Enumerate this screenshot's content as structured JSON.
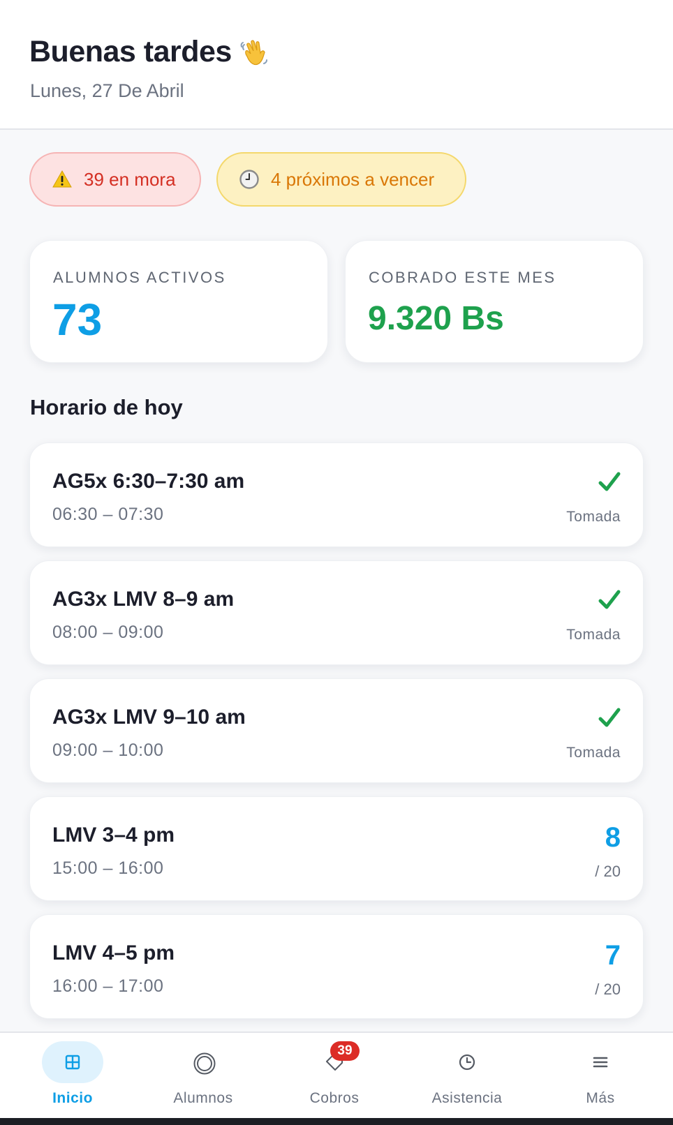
{
  "header": {
    "greeting": "Buenas tardes",
    "greeting_icon": "waving-hand-icon",
    "date": "Lunes, 27 De Abril"
  },
  "alerts": {
    "mora": {
      "icon": "warning-icon",
      "label": "39 en mora",
      "color": "#d42f23"
    },
    "vencer": {
      "icon": "clock-icon",
      "label": "4 próximos a vencer",
      "color": "#d97706"
    }
  },
  "stats": {
    "alumnos": {
      "label": "ALUMNOS ACTIVOS",
      "value": "73",
      "color": "#0e9ee5"
    },
    "cobrado": {
      "label": "COBRADO ESTE MES",
      "value": "9.320 Bs",
      "color": "#1ea14d"
    }
  },
  "schedule": {
    "title": "Horario de hoy",
    "classes": [
      {
        "name": "AG5x 6:30–7:30 am",
        "time": "06:30 – 07:30",
        "status": "Tomada"
      },
      {
        "name": "AG3x LMV 8–9 am",
        "time": "08:00 – 09:00",
        "status": "Tomada"
      },
      {
        "name": "AG3x LMV 9–10 am",
        "time": "09:00 – 10:00",
        "status": "Tomada"
      },
      {
        "name": "LMV 3–4 pm",
        "time": "15:00 – 16:00",
        "count": "8",
        "capacity": "/ 20"
      },
      {
        "name": "LMV 4–5 pm",
        "time": "16:00 – 17:00",
        "count": "7",
        "capacity": "/ 20"
      }
    ]
  },
  "nav": {
    "items": [
      {
        "label": "Inicio",
        "icon": "grid-icon",
        "active": true
      },
      {
        "label": "Alumnos",
        "icon": "target-icon"
      },
      {
        "label": "Cobros",
        "icon": "tag-icon",
        "badge": "39"
      },
      {
        "label": "Asistencia",
        "icon": "clock-icon"
      },
      {
        "label": "Más",
        "icon": "menu-icon"
      }
    ]
  },
  "colors": {
    "accent": "#0e9ee5",
    "success": "#1ea14d",
    "danger": "#dc2c26"
  }
}
